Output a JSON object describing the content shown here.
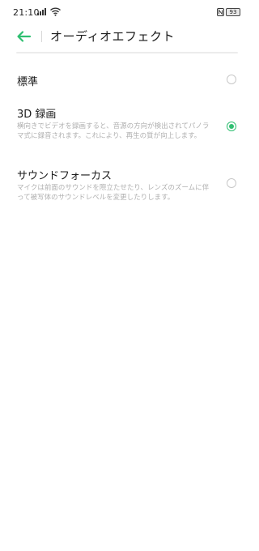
{
  "status_bar": {
    "time": "21:10",
    "battery": "93",
    "icons": [
      "signal-icon",
      "wifi-icon",
      "nfc-icon",
      "battery-icon"
    ]
  },
  "header": {
    "back_icon": "arrow-left-icon",
    "title": "オーディオエフェクト",
    "accent_color": "#2fbf71"
  },
  "options": [
    {
      "title": "標準",
      "description": "",
      "selected": false
    },
    {
      "title": "3D 録画",
      "description": "横向きでビデオを録画すると、音源の方向が検出されてパノラマ式に録音されます。これにより、再生の質が向上します。",
      "selected": true
    },
    {
      "title": "サウンドフォーカス",
      "description": "マイクは前面のサウンドを際立たせたり、レンズのズームに伴って被写体のサウンドレベルを変更したりします。",
      "selected": false
    }
  ]
}
